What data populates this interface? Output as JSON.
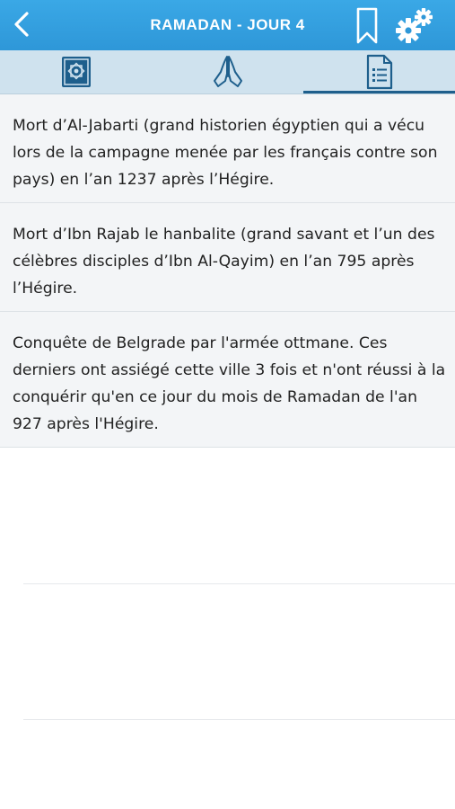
{
  "header": {
    "title": "RAMADAN - JOUR 4",
    "back_icon": "chevron-left-icon",
    "bookmark_icon": "bookmark-icon",
    "settings_icon": "gears-icon",
    "color": "#3aa8e6"
  },
  "tabs": [
    {
      "icon": "quran-book-icon",
      "selected": false
    },
    {
      "icon": "praying-hands-icon",
      "selected": false
    },
    {
      "icon": "document-list-icon",
      "selected": true
    }
  ],
  "entries": [
    {
      "text": "Mort d’Al-Jabarti (grand historien égyptien qui a vécu lors de la campagne menée par les français contre son pays) en l’an 1237 après l’Hégire."
    },
    {
      "text": "Mort d’Ibn Rajab le hanbalite (grand savant et l’un des célèbres disciples d’Ibn Al-Qayim) en l’an 795 après l’Hégire."
    },
    {
      "text": "Conquête de Belgrade par l'armée ottmane. Ces derniers ont assiégé cette ville 3 fois et n'ont réussi à la conquérir qu'en ce jour du mois de Ramadan de l'an 927 après l'Hégire."
    }
  ]
}
